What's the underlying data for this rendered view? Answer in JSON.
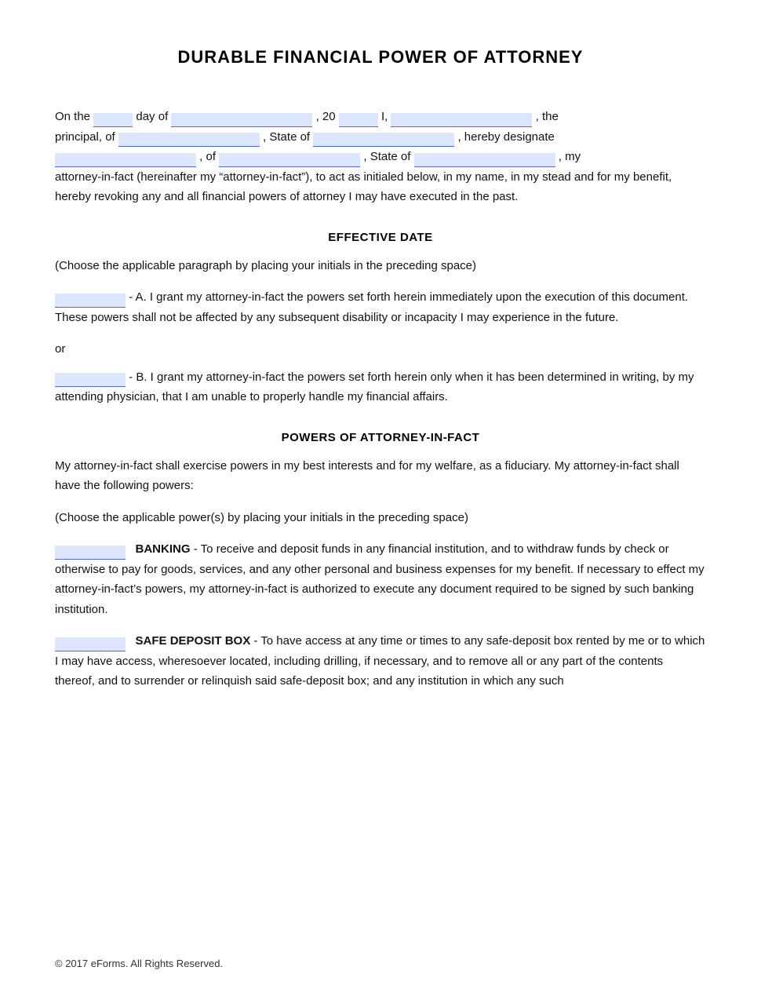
{
  "document": {
    "title": "DURABLE FINANCIAL POWER OF ATTORNEY",
    "intro": {
      "line1_prefix": "On the",
      "line1_day_placeholder": "",
      "line1_of_day": "day of",
      "line1_month_placeholder": "",
      "line1_year_prefix": ", 20",
      "line1_year_placeholder": "",
      "line1_i_prefix": "I,",
      "line1_name_placeholder": "",
      "line1_suffix": ", the",
      "line2_prefix": "principal, of",
      "line2_address_placeholder": "",
      "line2_state_prefix": ", State of",
      "line2_state_placeholder": "",
      "line2_suffix": ", hereby designate",
      "line3_name_placeholder": "",
      "line3_of": ", of",
      "line3_address_placeholder": "",
      "line3_state_prefix": ", State of",
      "line3_state_placeholder": "",
      "line3_suffix": ", my",
      "body": "attorney-in-fact (hereinafter my “attorney-in-fact”), to act as initialed below, in my name, in my stead and for my benefit, hereby revoking any and all financial powers of attorney I may have executed in the past."
    },
    "effective_date": {
      "heading": "EFFECTIVE DATE",
      "choose_text": "(Choose the applicable paragraph by placing your initials in the preceding space)",
      "option_a": "- A. I grant my attorney-in-fact the powers set forth herein immediately upon the execution of this document. These powers shall not be affected by any subsequent disability or incapacity I may experience in the future.",
      "or_text": "or",
      "option_b": "- B. I grant my attorney-in-fact the powers set forth herein only when it has been determined in writing, by my attending physician, that I am unable to properly handle my financial affairs."
    },
    "powers": {
      "heading": "POWERS OF ATTORNEY-IN-FACT",
      "intro": "My attorney-in-fact shall exercise powers in my best interests and for my welfare, as a fiduciary. My attorney-in-fact shall have the following powers:",
      "choose_text": "(Choose the applicable power(s) by placing your initials in the preceding space)",
      "banking_label": "BANKING",
      "banking_text": "- To receive and deposit funds in any financial institution, and to withdraw funds by check or otherwise to pay for goods, services, and any other personal and business expenses for my benefit.  If necessary to effect my attorney-in-fact’s powers, my attorney-in-fact is authorized to execute any document required to be signed by such banking institution.",
      "safe_deposit_label": "SAFE DEPOSIT BOX",
      "safe_deposit_text": "- To have access at any time or times to any safe-deposit box rented by me or to which I may have access, wheresoever located, including drilling, if necessary, and to remove all or any part of the contents thereof, and to surrender or relinquish said safe-deposit box; and any institution in which any such"
    },
    "footer": {
      "copyright": "© 2017 eForms. All Rights Reserved."
    }
  }
}
